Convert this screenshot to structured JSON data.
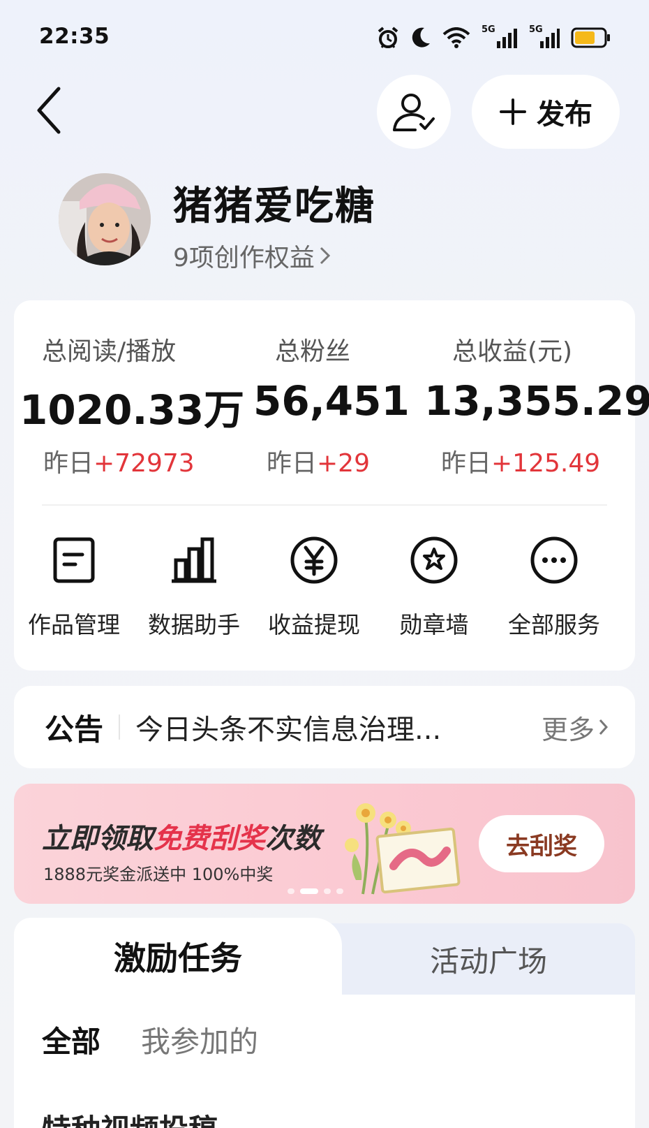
{
  "status_bar": {
    "time": "22:35",
    "signal_1_label": "5G",
    "signal_2_label": "5G",
    "icons": [
      "alarm-icon",
      "moon-icon",
      "wifi-icon",
      "signal-icon",
      "signal-icon",
      "battery-icon"
    ],
    "battery_level": 0.7
  },
  "header": {
    "publish_label": "发布",
    "publish_icon": "plus-icon"
  },
  "profile": {
    "username": "猪猪爱吃糖",
    "rights_link": "9项创作权益"
  },
  "stats": [
    {
      "label": "总阅读/播放",
      "value": "1020.33万",
      "delta_prefix": "昨日",
      "delta": "+72973"
    },
    {
      "label": "总粉丝",
      "value": "56,451",
      "delta_prefix": "昨日",
      "delta": "+29"
    },
    {
      "label": "总收益(元)",
      "value": "13,355.29",
      "delta_prefix": "昨日",
      "delta": "+125.49"
    }
  ],
  "services": [
    {
      "label": "作品管理",
      "icon": "document-icon"
    },
    {
      "label": "数据助手",
      "icon": "bar-chart-icon"
    },
    {
      "label": "收益提现",
      "icon": "yen-icon"
    },
    {
      "label": "勋章墙",
      "icon": "medal-icon"
    },
    {
      "label": "全部服务",
      "icon": "more-icon"
    }
  ],
  "notice": {
    "title": "公告",
    "text": "今日头条不实信息治理...",
    "more": "更多"
  },
  "banner": {
    "title_part1": "立即领取",
    "title_highlight": "免费刮奖",
    "title_part2": "次数",
    "subtitle": "1888元奖金派送中 100%中奖",
    "button": "去刮奖",
    "accent_color": "#e5334b"
  },
  "tasks": {
    "tab_active": "激励任务",
    "tab_inactive": "活动广场",
    "filter_all": "全部",
    "filter_mine": "我参加的",
    "peek_item": "特种视频投稿"
  }
}
